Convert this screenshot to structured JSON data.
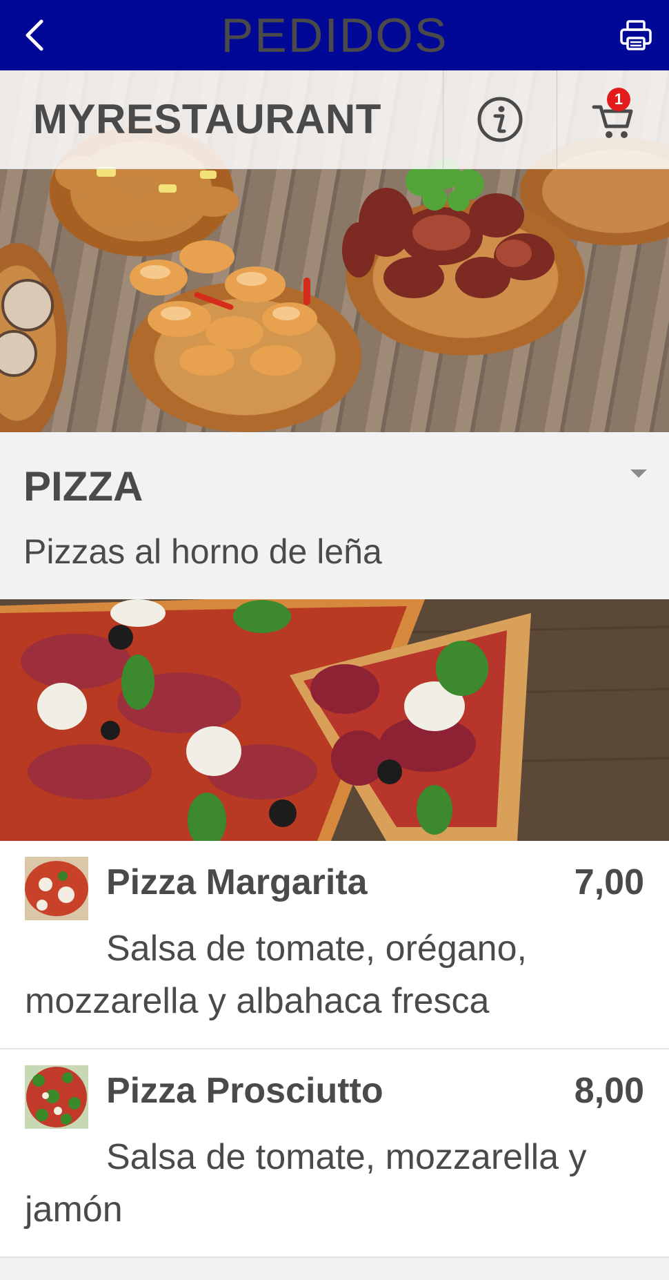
{
  "topbar": {
    "title": "PEDIDOS",
    "back_icon": "chevron-left-icon",
    "print_icon": "printer-icon",
    "background": "#020896"
  },
  "header": {
    "restaurant_name": "MYRESTAURANT",
    "info_icon": "info-icon",
    "cart_icon": "cart-icon",
    "cart_count": "1"
  },
  "section": {
    "title": "PIZZA",
    "subtitle": "Pizzas al horno de leña"
  },
  "items": [
    {
      "name": "Pizza Margarita",
      "price": "7,00",
      "description": "Salsa de tomate, orégano, mozzarella y albahaca fresca"
    },
    {
      "name": "Pizza Prosciutto",
      "price": "8,00",
      "description": "Salsa de tomate, mozzarella y jamón"
    }
  ]
}
